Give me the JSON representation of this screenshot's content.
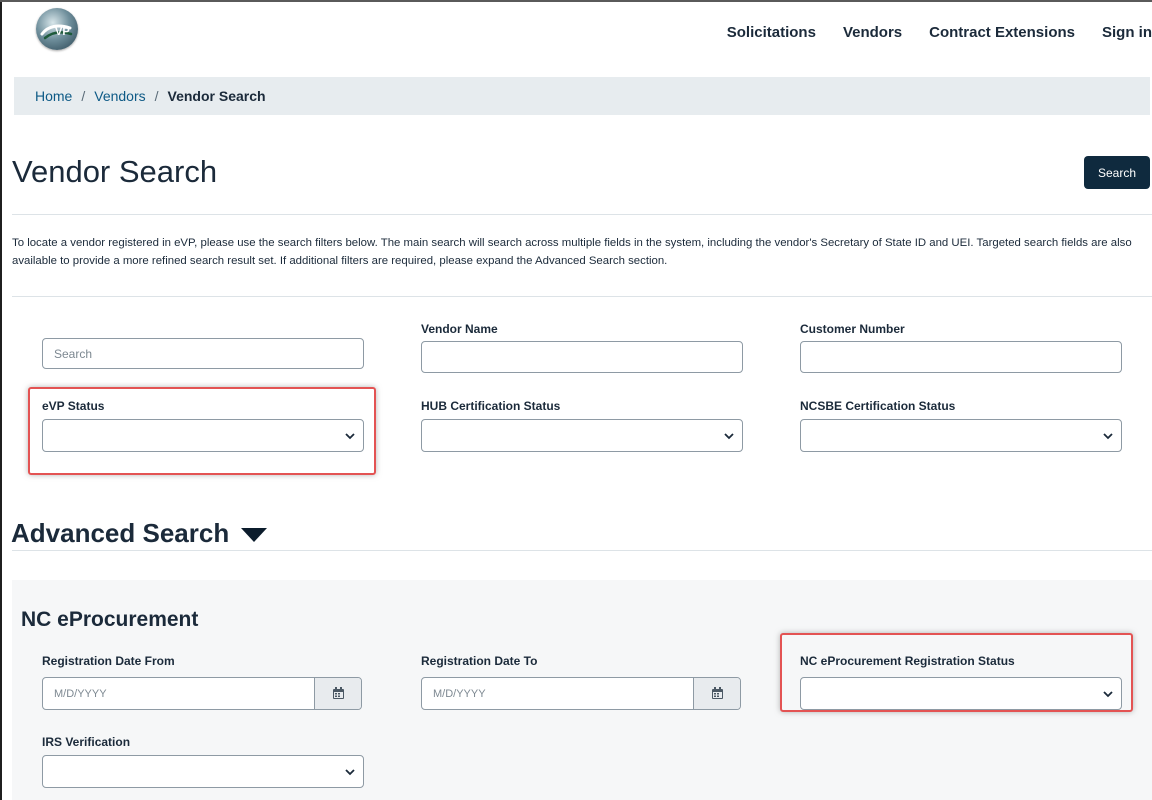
{
  "nav": {
    "logo_icon": "evp-logo-icon",
    "links": [
      "Solicitations",
      "Vendors",
      "Contract Extensions",
      "Sign in"
    ]
  },
  "breadcrumb": {
    "home": "Home",
    "vendors": "Vendors",
    "current": "Vendor Search",
    "separator": "/"
  },
  "page": {
    "title": "Vendor Search",
    "search_button": "Search",
    "intro": "To locate a vendor registered in eVP, please use the search filters below. The main search will search across multiple fields in the system, including the vendor's Secretary of State ID and UEI. Targeted search fields are also available to provide a more refined search result set. If additional filters are required, please expand the Advanced Search section."
  },
  "filters": {
    "main_search_placeholder": "Search",
    "vendor_name": {
      "label": "Vendor Name",
      "value": ""
    },
    "customer_number": {
      "label": "Customer Number",
      "value": ""
    },
    "evp_status": {
      "label": "eVP Status",
      "selected": ""
    },
    "hub_status": {
      "label": "HUB Certification Status",
      "selected": ""
    },
    "ncsbe_status": {
      "label": "NCSBE Certification Status",
      "selected": ""
    }
  },
  "advanced": {
    "title": "Advanced Search",
    "expanded": true,
    "section_title": "NC eProcurement",
    "reg_date_from": {
      "label": "Registration Date From",
      "placeholder": "M/D/YYYY",
      "icon": "calendar-icon"
    },
    "reg_date_to": {
      "label": "Registration Date To",
      "placeholder": "M/D/YYYY",
      "icon": "calendar-icon"
    },
    "reg_status": {
      "label": "NC eProcurement Registration Status",
      "selected": ""
    },
    "irs_verification": {
      "label": "IRS Verification",
      "selected": ""
    }
  },
  "colors": {
    "primary_dark": "#0f2a3e",
    "link": "#0e5a86",
    "breadcrumb_bg": "#e7ecef",
    "highlight": "#e35353",
    "section_bg": "#f6f7f8"
  }
}
